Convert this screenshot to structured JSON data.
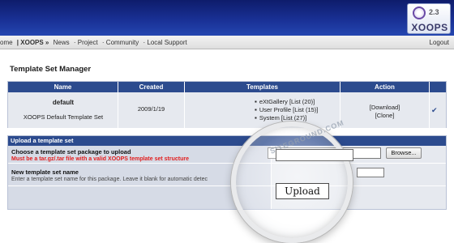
{
  "header": {
    "logo_version": "2.3",
    "logo_name": "XOOPS"
  },
  "nav": {
    "items": [
      "ome",
      "| XOOPS »",
      "News",
      "· Project",
      "· Community",
      "· Local Support"
    ],
    "logout": "Logout"
  },
  "page": {
    "title": "Template Set Manager"
  },
  "table": {
    "headers": [
      "Name",
      "Created",
      "Templates",
      "Action"
    ],
    "row": {
      "name": "default",
      "description": "XOOPS Default Template Set",
      "created": "2009/1/19",
      "templates": [
        "eXtGallery [List (20)]",
        "User Profile [List (15)]",
        "System [List (27)]"
      ],
      "action_download": "[Download]",
      "action_clone": "[Clone]",
      "check_icon": "✔"
    }
  },
  "upload": {
    "header": "Upload a template set",
    "choose_label": "Choose a template set package to upload",
    "warning": "Must be a tar.gz/.tar file with a valid XOOPS template set structure",
    "name_label": "New template set name",
    "name_desc": "Enter a template set name for this package. Leave it blank for automatic detec",
    "browse_label": "Browse...",
    "upload_label": "Upload",
    "watermark": "SITEGROUND.COM"
  },
  "colors": {
    "header_bg": "#1a3298",
    "table_head": "#2c4b8e",
    "row_bg": "#e6e9ef",
    "warning": "#e21d1d"
  }
}
